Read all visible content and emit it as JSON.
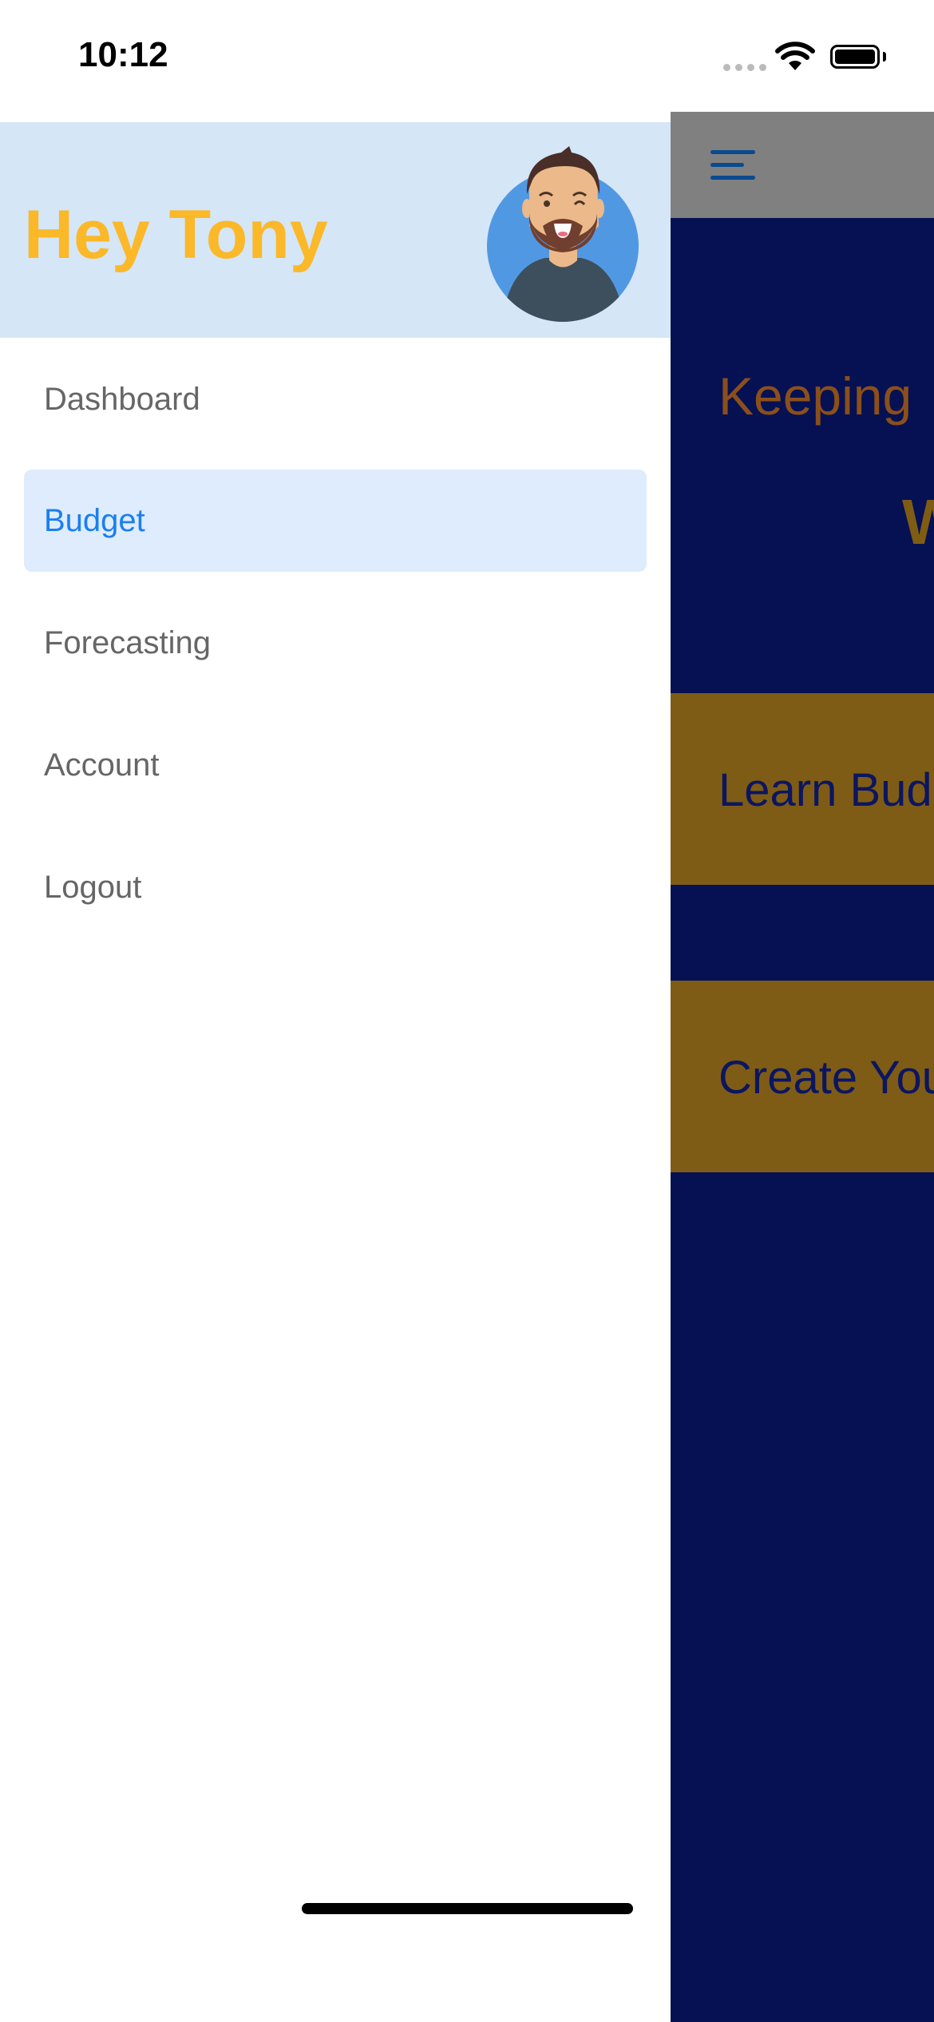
{
  "status_bar": {
    "time": "10:12",
    "icons": [
      "signal-dots-icon",
      "wifi-icon",
      "battery-icon"
    ]
  },
  "drawer": {
    "greeting": "Hey Tony",
    "avatar": "avatar-cartoon-man",
    "items": [
      {
        "label": "Dashboard",
        "active": false
      },
      {
        "label": "Budget",
        "active": true
      },
      {
        "label": "Forecasting",
        "active": false
      },
      {
        "label": "Account",
        "active": false
      },
      {
        "label": "Logout",
        "active": false
      }
    ]
  },
  "main": {
    "menu_icon": "hamburger-icon",
    "headline": "Keeping",
    "subheadline": "W",
    "cards": [
      {
        "label": "Learn Bud"
      },
      {
        "label": "Create You"
      }
    ]
  },
  "colors": {
    "accent": "#1a7ff0",
    "greeting": "#fbb829",
    "main_bg": "#061153",
    "card_bg": "#7e5c16",
    "header_bg": "#d5e6f7"
  }
}
